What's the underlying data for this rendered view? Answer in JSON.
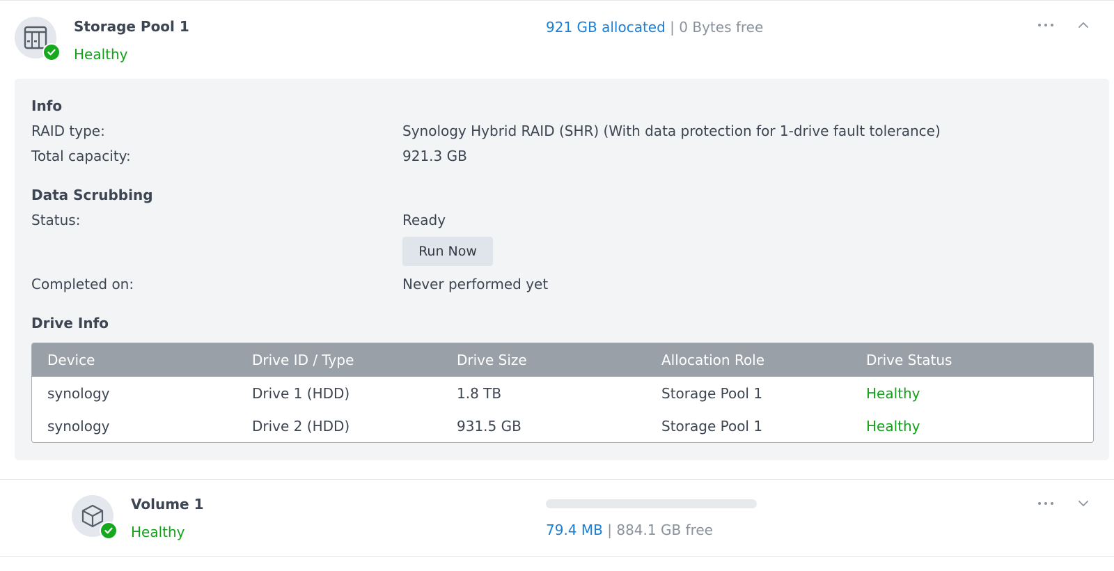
{
  "storage_pool": {
    "title": "Storage Pool 1",
    "status": "Healthy",
    "allocated": "921 GB allocated",
    "separator": "|",
    "free": "0 Bytes free",
    "icon": "nas-device-icon",
    "expanded": true
  },
  "info": {
    "heading": "Info",
    "raid_type_label": "RAID type:",
    "raid_type_value": "Synology Hybrid RAID (SHR) (With data protection for 1-drive fault tolerance)",
    "total_capacity_label": "Total capacity:",
    "total_capacity_value": "921.3 GB"
  },
  "scrubbing": {
    "heading": "Data Scrubbing",
    "status_label": "Status:",
    "status_value": "Ready",
    "run_button": "Run Now",
    "completed_label": "Completed on:",
    "completed_value": "Never performed yet"
  },
  "drive_info": {
    "heading": "Drive Info",
    "columns": [
      "Device",
      "Drive ID / Type",
      "Drive Size",
      "Allocation Role",
      "Drive Status"
    ],
    "rows": [
      [
        "synology",
        "Drive 1 (HDD)",
        "1.8 TB",
        "Storage Pool 1",
        "Healthy"
      ],
      [
        "synology",
        "Drive 2 (HDD)",
        "931.5 GB",
        "Storage Pool 1",
        "Healthy"
      ]
    ]
  },
  "volume": {
    "title": "Volume 1",
    "status": "Healthy",
    "used": "79.4 MB",
    "separator": "|",
    "free": "884.1 GB free",
    "usage_fraction": 0.0001,
    "icon": "cube-icon",
    "expanded": false
  },
  "colors": {
    "healthy": "#14a01b",
    "accent": "#1a7fd6",
    "table_header": "#9aa0a7",
    "panel_bg": "#f2f4f6"
  }
}
